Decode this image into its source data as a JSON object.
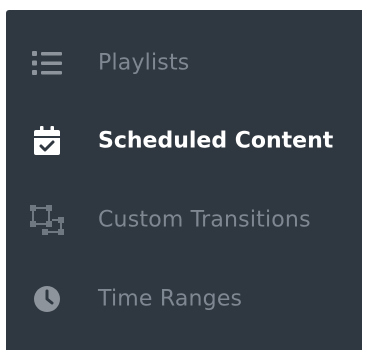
{
  "sidebar": {
    "items": [
      {
        "label": "Playlists",
        "icon": "list-icon",
        "active": false
      },
      {
        "label": "Scheduled Content",
        "icon": "calendar-check-icon",
        "active": true
      },
      {
        "label": "Custom Transitions",
        "icon": "transitions-icon",
        "active": false
      },
      {
        "label": "Time Ranges",
        "icon": "clock-icon",
        "active": false
      }
    ]
  },
  "colors": {
    "sidebar_background": "#2f3740",
    "inactive_text": "#7f8892",
    "active_text": "#ffffff",
    "inactive_icon": "#8d949c"
  }
}
